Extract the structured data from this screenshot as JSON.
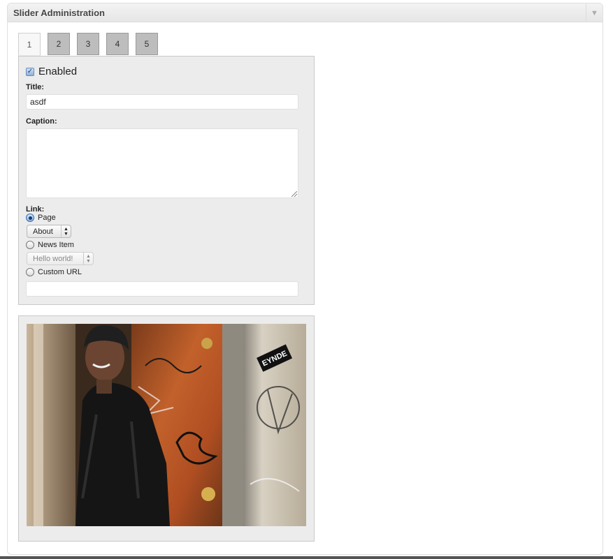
{
  "panel": {
    "title": "Slider Administration"
  },
  "tabs": [
    {
      "label": "1",
      "active": true
    },
    {
      "label": "2",
      "active": false
    },
    {
      "label": "3",
      "active": false
    },
    {
      "label": "4",
      "active": false
    },
    {
      "label": "5",
      "active": false
    }
  ],
  "form": {
    "enabled_label": "Enabled",
    "enabled_checked": true,
    "title_label": "Title:",
    "title_value": "asdf",
    "caption_label": "Caption:",
    "caption_value": "",
    "link_label": "Link:",
    "link_options": {
      "page_label": "Page",
      "page_selected": "About",
      "news_label": "News Item",
      "news_selected": "Hello world!",
      "custom_label": "Custom URL",
      "custom_value": ""
    },
    "selected_link_type": "page"
  },
  "image": {
    "description_icon": "photo",
    "sticker_text": "EYNDE"
  },
  "colors": {
    "tab_inactive": "#bdbdbd",
    "box_background": "#ececec",
    "header_text": "#464646"
  }
}
